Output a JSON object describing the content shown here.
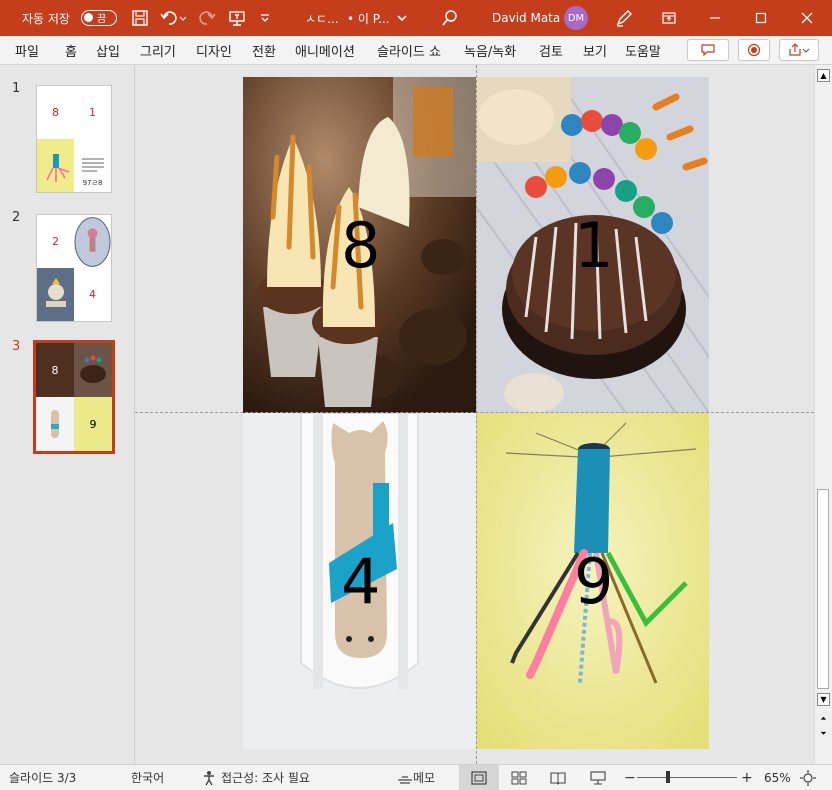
{
  "titlebar": {
    "autosave_label": "자동 저장",
    "autosave_state": "끔",
    "doc_title": "ㅅㄷ...",
    "doc_status": "• 이 P...",
    "user_name": "David Mata",
    "user_initials": "DM",
    "accent": "#c43e1c"
  },
  "ribbon": {
    "tabs": [
      "파일",
      "홈",
      "삽입",
      "그리기",
      "디자인",
      "전환",
      "애니메이션",
      "슬라이드 쇼",
      "녹음/녹화",
      "검토",
      "보기",
      "도움말"
    ]
  },
  "thumbnails": [
    {
      "number": "1",
      "cells": [
        "8",
        "1",
        "",
        "97ㄹ8"
      ]
    },
    {
      "number": "2",
      "cells": [
        "2",
        "",
        "",
        "4"
      ]
    },
    {
      "number": "3",
      "cells": [
        "8",
        "",
        "",
        "9"
      ]
    }
  ],
  "slide": {
    "numbers": [
      "8",
      "1",
      "4",
      "9"
    ]
  },
  "status": {
    "slide_indicator": "슬라이드 3/3",
    "language": "한국어",
    "accessibility": "접근성: 조사 필요",
    "notes": "메모",
    "zoom_level": 0.65,
    "zoom": "65%"
  }
}
